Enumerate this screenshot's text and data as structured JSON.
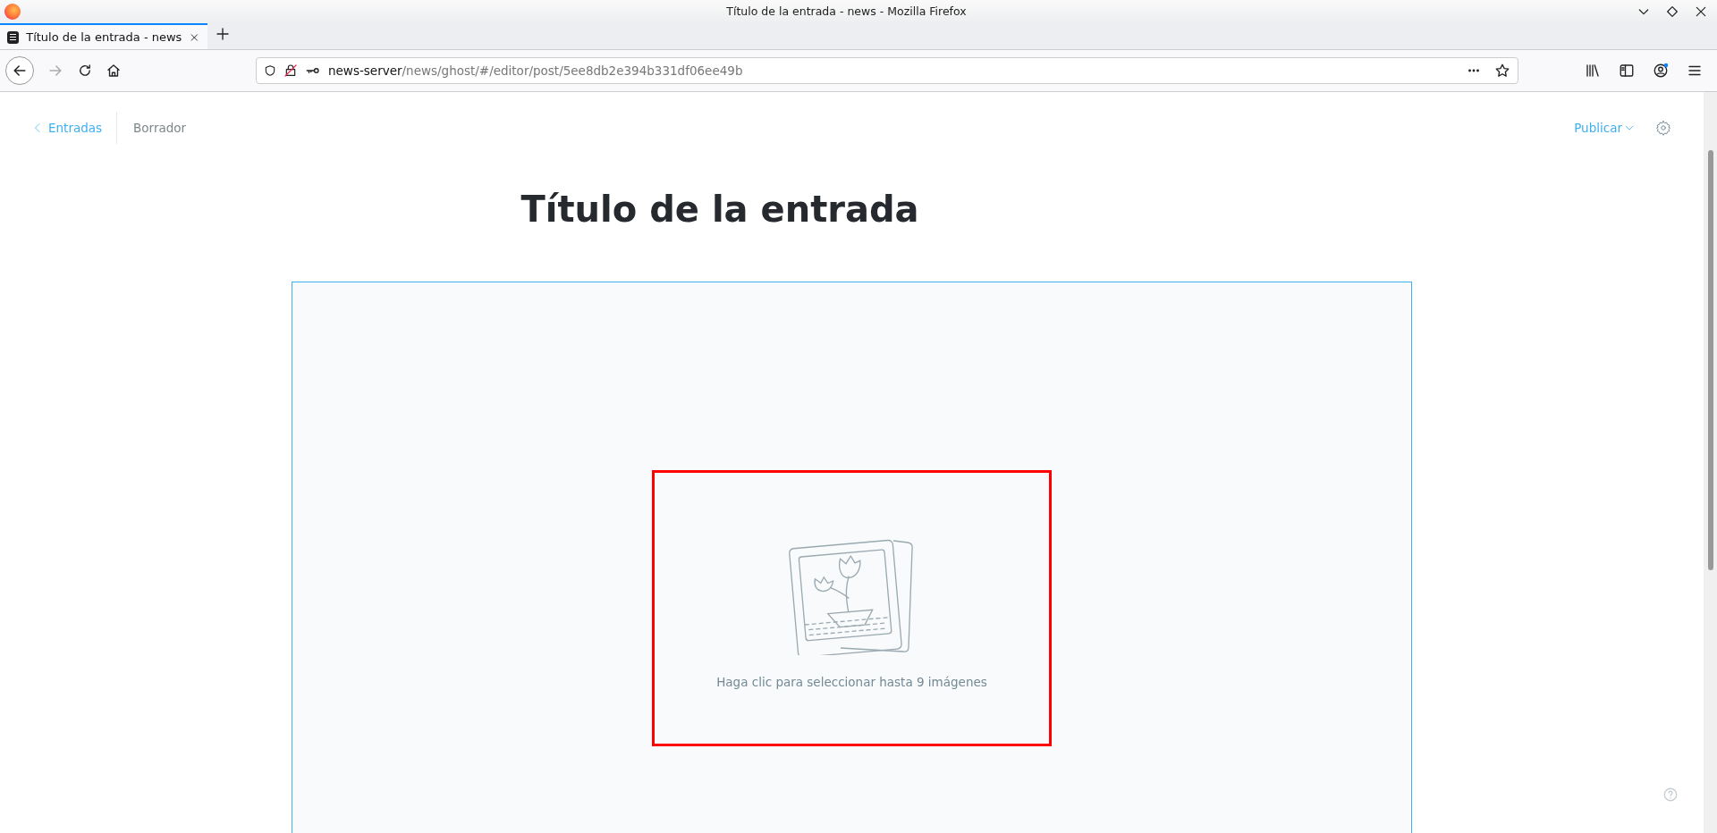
{
  "window": {
    "title": "Título de la entrada - news - Mozilla Firefox"
  },
  "tabs": [
    {
      "label": "Título de la entrada - news",
      "selected": true
    }
  ],
  "address_bar": {
    "host": "news-server",
    "path": "/news/ghost/#/editor/post/5ee8db2e394b331df06ee49b"
  },
  "editor": {
    "back_link": "Entradas",
    "status": "Borrador",
    "publish": "Publicar",
    "title": "Título de la entrada",
    "gallery": {
      "hint": "Haga clic para seleccionar hasta 9 imágenes",
      "highlighted": true
    }
  }
}
